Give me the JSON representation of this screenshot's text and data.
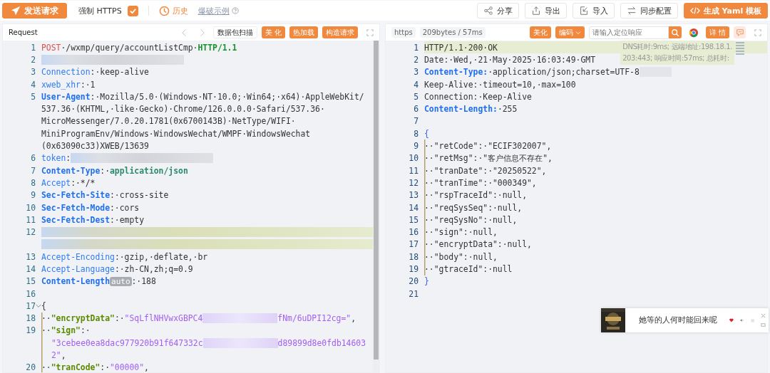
{
  "toolbar": {
    "send_button": "发送请求",
    "force_https": {
      "label": "强制 HTTPS",
      "checked": true
    },
    "history": "历史",
    "example_link": "爆破示例",
    "actions": [
      {
        "label": "分享",
        "primary": false
      },
      {
        "label": "导出",
        "primary": false
      },
      {
        "label": "导入",
        "primary": false
      },
      {
        "label": "同步配置",
        "primary": false
      },
      {
        "label": "生成 Yaml 模板",
        "primary": true
      }
    ]
  },
  "request": {
    "title": "Request",
    "scan_button": "数据包扫描",
    "buttons": [
      "美 化",
      "热加载",
      "构造请求"
    ],
    "lines": [
      {
        "n": "1",
        "rows": [
          [
            {
              "kind": "method",
              "text": "POST"
            },
            {
              "kind": "plain",
              "text": "·/wxmp/query/accountListCmp·"
            },
            {
              "kind": "proto",
              "text": "HTTP/1.1"
            }
          ]
        ]
      },
      {
        "n": "2",
        "rows": [
          [
            {
              "kind": "redacted_long"
            }
          ]
        ]
      },
      {
        "n": "3",
        "rows": [
          [
            {
              "kind": "key",
              "text": "Connection"
            },
            {
              "kind": "plain",
              "text": ":·keep-alive"
            }
          ]
        ]
      },
      {
        "n": "4",
        "rows": [
          [
            {
              "kind": "key",
              "text": "xweb_xhr"
            },
            {
              "kind": "plain",
              "text": ":·1"
            }
          ]
        ]
      },
      {
        "n": "5",
        "rows": [
          [
            {
              "kind": "bkey",
              "text": "User-Agent"
            },
            {
              "kind": "plain",
              "text": ":·Mozilla/5.0·(Windows·NT·10.0;·Win64;·x64)·AppleWebKit/"
            }
          ],
          [
            {
              "kind": "plain",
              "text": "537.36·(KHTML,·like·Gecko)·Chrome/126.0.0.0·Safari/537.36·"
            }
          ],
          [
            {
              "kind": "plain",
              "text": "MicroMessenger/7.0.20.1781(0x6700143B)·NetType/WIFI·"
            }
          ],
          [
            {
              "kind": "plain",
              "text": "MiniProgramEnv/Windows·WindowsWechat/WMPF·WindowsWechat"
            }
          ],
          [
            {
              "kind": "plain",
              "text": "(0x63090c33)XWEB/13639"
            }
          ]
        ]
      },
      {
        "n": "6",
        "rows": [
          [
            {
              "kind": "key",
              "text": "token"
            },
            {
              "kind": "plain",
              "text": ":"
            },
            {
              "kind": "redacted_long"
            }
          ]
        ]
      },
      {
        "n": "7",
        "rows": [
          [
            {
              "kind": "bkey",
              "text": "Content-Type"
            },
            {
              "kind": "plain",
              "text": ":·"
            },
            {
              "kind": "green",
              "text": "application/json"
            }
          ]
        ]
      },
      {
        "n": "8",
        "rows": [
          [
            {
              "kind": "key",
              "text": "Accept"
            },
            {
              "kind": "plain",
              "text": ":·*/*"
            }
          ]
        ]
      },
      {
        "n": "9",
        "rows": [
          [
            {
              "kind": "bkey",
              "text": "Sec-Fetch-Site"
            },
            {
              "kind": "plain",
              "text": ":·cross-site"
            }
          ]
        ]
      },
      {
        "n": "10",
        "rows": [
          [
            {
              "kind": "bkey",
              "text": "Sec-Fetch-Mode"
            },
            {
              "kind": "plain",
              "text": ":·cors"
            }
          ]
        ]
      },
      {
        "n": "11",
        "rows": [
          [
            {
              "kind": "bkey",
              "text": "Sec-Fetch-Dest"
            },
            {
              "kind": "plain",
              "text": ":·empty"
            }
          ]
        ]
      },
      {
        "n": "12",
        "rows": [
          [
            {
              "kind": "redacted_wide"
            }
          ],
          [
            {
              "kind": "redacted_wide"
            }
          ]
        ]
      },
      {
        "n": "13",
        "rows": [
          [
            {
              "kind": "key",
              "text": "Accept-Encoding"
            },
            {
              "kind": "plain",
              "text": ":·gzip,·deflate,·br"
            }
          ]
        ]
      },
      {
        "n": "14",
        "rows": [
          [
            {
              "kind": "key",
              "text": "Accept-Language"
            },
            {
              "kind": "plain",
              "text": ":·zh-CN,zh;q=0.9"
            }
          ]
        ]
      },
      {
        "n": "15",
        "rows": [
          [
            {
              "kind": "bkey",
              "text": "Content-Length"
            },
            {
              "kind": "badge",
              "text": "auto"
            },
            {
              "kind": "plain",
              "text": ":·188"
            }
          ]
        ]
      },
      {
        "n": "16",
        "rows": [
          []
        ]
      },
      {
        "n": "17",
        "foldable": true,
        "rows": [
          [
            {
              "kind": "plain",
              "text": "{"
            }
          ]
        ]
      },
      {
        "n": "18",
        "guide": true,
        "rows": [
          [
            {
              "kind": "plain",
              "text": "··"
            },
            {
              "kind": "jkey",
              "text": "\"encryptData\""
            },
            {
              "kind": "plain",
              "text": ":·"
            },
            {
              "kind": "jstr",
              "text": "\"SqLflNHVwxGBPC4"
            },
            {
              "kind": "redacted"
            },
            {
              "kind": "jstr",
              "text": "fNm/6uDPI12cg=\""
            },
            {
              "kind": "plain",
              "text": ","
            }
          ]
        ]
      },
      {
        "n": "19",
        "guide": true,
        "rows": [
          [
            {
              "kind": "plain",
              "text": "··"
            },
            {
              "kind": "jkey",
              "text": "\"sign\""
            },
            {
              "kind": "plain",
              "text": ":·"
            }
          ],
          [
            {
              "kind": "jstr",
              "text": "\"3cebee0ea8dac977920b91f647332c"
            },
            {
              "kind": "redacted"
            },
            {
              "kind": "jstr",
              "text": "d89899d8e0fdb14603"
            }
          ],
          [
            {
              "kind": "jstr",
              "text": "2\""
            },
            {
              "kind": "plain",
              "text": ","
            }
          ]
        ]
      },
      {
        "n": "20",
        "guide": true,
        "rows": [
          [
            {
              "kind": "plain",
              "text": "··"
            },
            {
              "kind": "jkey",
              "text": "\"tranCode\""
            },
            {
              "kind": "plain",
              "text": ":·"
            },
            {
              "kind": "jstr",
              "text": "\"00000\""
            },
            {
              "kind": "plain",
              "text": ","
            }
          ]
        ]
      }
    ]
  },
  "response": {
    "scheme": "https",
    "stats": "209bytes / 57ms",
    "beautify": "美化",
    "encode": "编码",
    "search": {
      "placeholder": "请输入定位响应"
    },
    "details": "详 情",
    "timing_note": [
      "DNS耗时:9ms; 远端地址:198.18.1.",
      "203:443; 响应时间:57ms; 总耗时:"
    ],
    "lines": [
      {
        "n": "1",
        "highlighted": true,
        "rows": [
          [
            {
              "kind": "plain",
              "text": "HTTP/1.1·200·OK"
            }
          ]
        ]
      },
      {
        "n": "2",
        "rows": [
          [
            {
              "kind": "plain",
              "text": "Date:·Wed,·21·May·2025·16:03:49·GMT"
            }
          ]
        ]
      },
      {
        "n": "3",
        "rows": [
          [
            {
              "kind": "bkey",
              "text": "Content-Type:"
            },
            {
              "kind": "plain",
              "text": "·application/json;charset=UTF-8"
            },
            {
              "kind": "redacted_short"
            }
          ]
        ]
      },
      {
        "n": "4",
        "rows": [
          [
            {
              "kind": "plain",
              "text": "Keep-Alive:·timeout=10,·max=100"
            }
          ]
        ]
      },
      {
        "n": "5",
        "rows": [
          [
            {
              "kind": "plain",
              "text": "Connection:·Keep-Alive"
            }
          ]
        ]
      },
      {
        "n": "6",
        "rows": [
          [
            {
              "kind": "bkey",
              "text": "Content-Length:"
            },
            {
              "kind": "plain",
              "text": "·255"
            }
          ]
        ]
      },
      {
        "n": "7",
        "rows": [
          []
        ]
      },
      {
        "n": "8",
        "rows": [
          [
            {
              "kind": "brace",
              "text": "{"
            }
          ]
        ]
      },
      {
        "n": "9",
        "guide": true,
        "rows": [
          [
            {
              "kind": "plain",
              "text": "··\"retCode\":·\"ECIF302007\","
            }
          ]
        ]
      },
      {
        "n": "10",
        "guide": true,
        "rows": [
          [
            {
              "kind": "plain",
              "text": "··\"retMsg\":·\"客户信息不存在\","
            }
          ]
        ]
      },
      {
        "n": "11",
        "guide": true,
        "rows": [
          [
            {
              "kind": "plain",
              "text": "··\"tranDate\":·\"20250522\","
            }
          ]
        ]
      },
      {
        "n": "12",
        "guide": true,
        "rows": [
          [
            {
              "kind": "plain",
              "text": "··\"tranTime\":·\"000349\","
            }
          ]
        ]
      },
      {
        "n": "13",
        "guide": true,
        "rows": [
          [
            {
              "kind": "plain",
              "text": "··\"rspTraceId\":·null,"
            }
          ]
        ]
      },
      {
        "n": "14",
        "guide": true,
        "rows": [
          [
            {
              "kind": "plain",
              "text": "··\"reqSysSeq\":·null,"
            }
          ]
        ]
      },
      {
        "n": "15",
        "guide": true,
        "rows": [
          [
            {
              "kind": "plain",
              "text": "··\"reqSysNo\":·null,"
            }
          ]
        ]
      },
      {
        "n": "16",
        "guide": true,
        "rows": [
          [
            {
              "kind": "plain",
              "text": "··\"sign\":·null,"
            }
          ]
        ]
      },
      {
        "n": "17",
        "guide": true,
        "rows": [
          [
            {
              "kind": "plain",
              "text": "··\"encryptData\":·null,"
            }
          ]
        ]
      },
      {
        "n": "18",
        "guide": true,
        "rows": [
          [
            {
              "kind": "plain",
              "text": "··\"body\":·null,"
            }
          ]
        ]
      },
      {
        "n": "19",
        "guide": true,
        "rows": [
          [
            {
              "kind": "plain",
              "text": "··\"gtraceId\":·null"
            }
          ]
        ]
      },
      {
        "n": "20",
        "rows": [
          [
            {
              "kind": "brace",
              "text": "}"
            }
          ]
        ]
      },
      {
        "n": "21",
        "rows": [
          []
        ]
      }
    ]
  },
  "music_player": {
    "song": "她等的人何时能回来呢",
    "liked": true
  }
}
